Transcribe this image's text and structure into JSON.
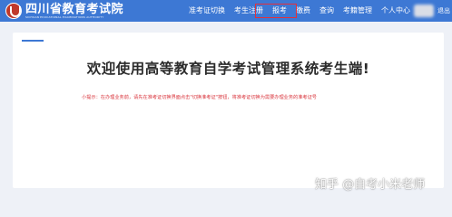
{
  "header": {
    "logo_title": "四川省教育考试院",
    "logo_subtitle": "SICHUAN EDUCATIONAL EXAMINATIONS AUTHORITY",
    "nav_items": [
      {
        "label": "准考证切换"
      },
      {
        "label": "考生注册"
      },
      {
        "label": "报考"
      },
      {
        "label": "缴费"
      },
      {
        "label": "查询"
      },
      {
        "label": "考籍管理"
      },
      {
        "label": "个人中心"
      }
    ],
    "user_exit": "退出"
  },
  "main": {
    "welcome": "欢迎使用高等教育自学考试管理系统考生端!",
    "tip": "小提示：在办理业务前，请先在准考证切换界面点击\"切换准考证\"按钮，将准考证切换为需要办理业务的准考证号"
  },
  "watermark": "知乎 @自考小米老师",
  "colors": {
    "header_bg": "#3d78d4",
    "highlight": "#e3303a",
    "tip": "#d9343c"
  }
}
